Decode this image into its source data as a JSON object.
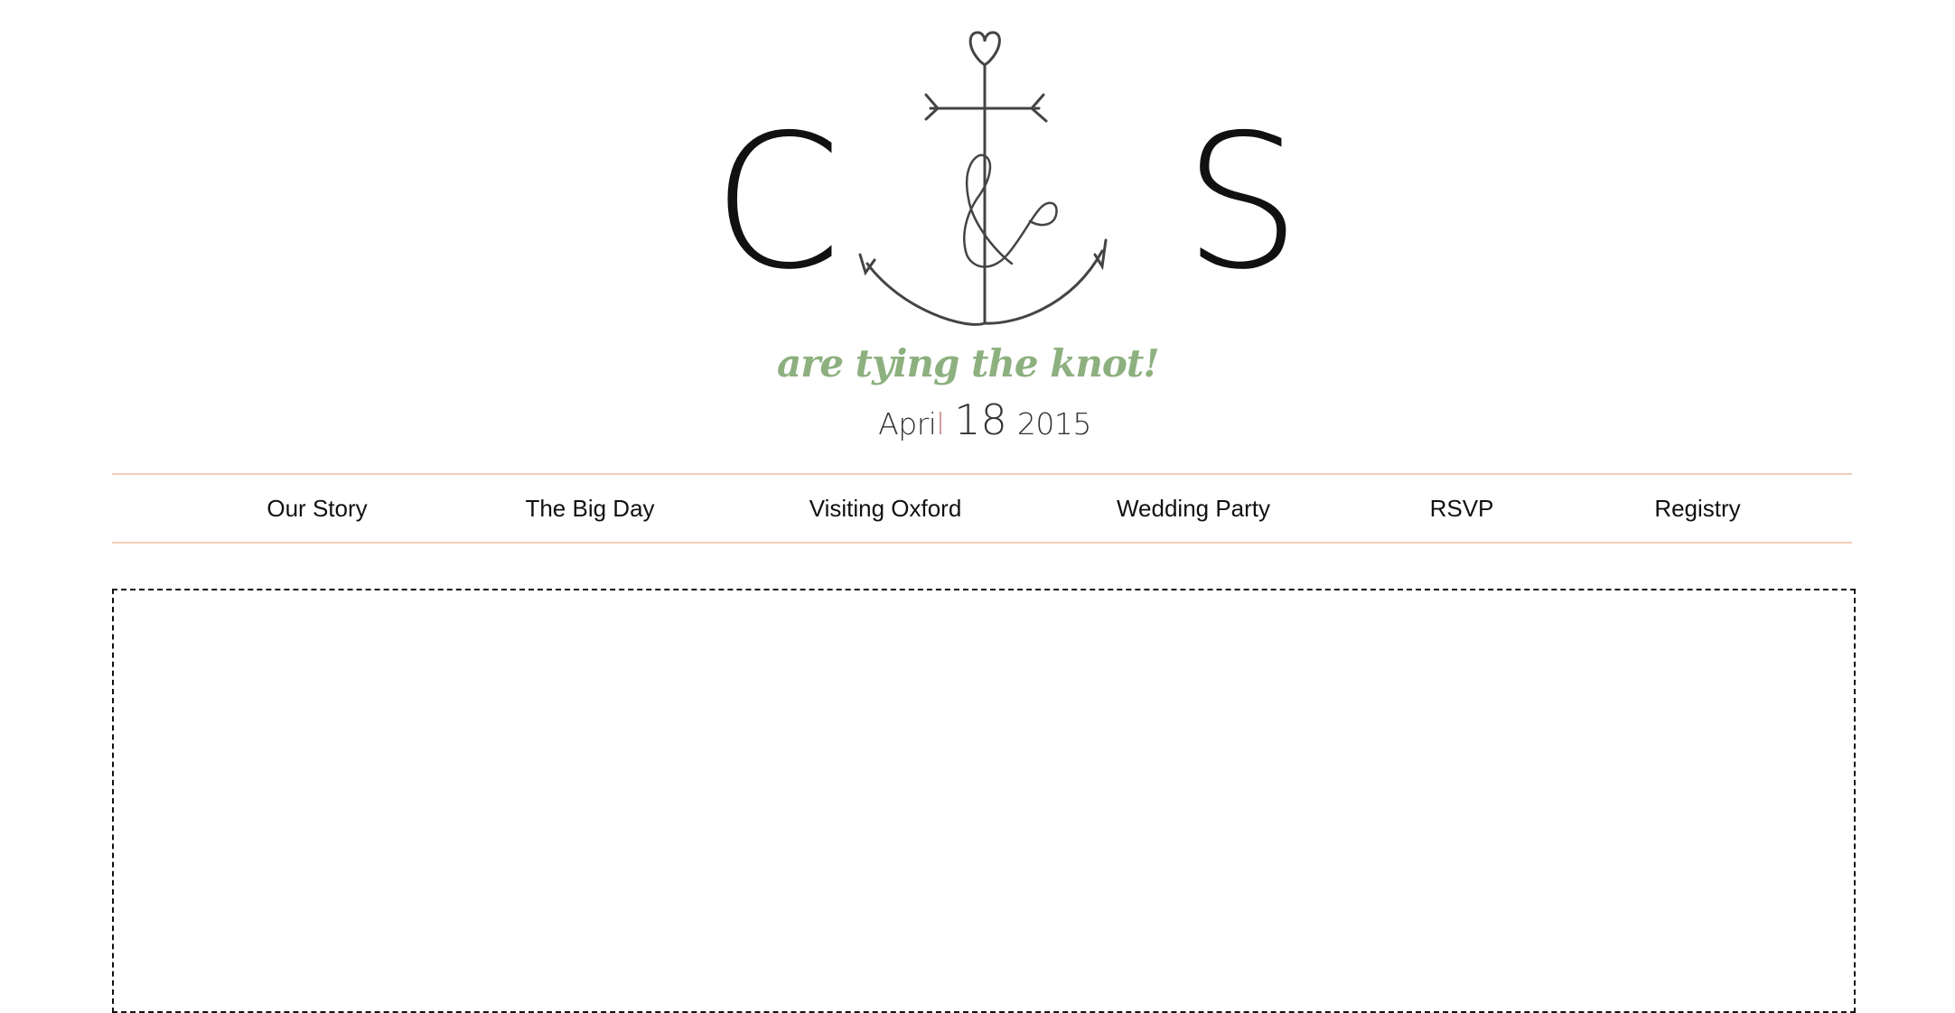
{
  "header": {
    "monogram": {
      "left_initial": "C",
      "right_initial": "S",
      "icon": "anchor-ampersand-icon"
    },
    "tagline": "are tying the knot!",
    "date": {
      "month_lead": "Apri",
      "month_tail": "l",
      "day": "18",
      "year": "2015"
    }
  },
  "nav": {
    "items": [
      {
        "label": "Our Story"
      },
      {
        "label": "The Big Day"
      },
      {
        "label": "Visiting Oxford"
      },
      {
        "label": "Wedding Party"
      },
      {
        "label": "RSVP"
      },
      {
        "label": "Registry"
      }
    ]
  },
  "colors": {
    "accent_green": "#8db07f",
    "nav_border": "#f5cdb8",
    "date_accent": "#c47a7a"
  }
}
